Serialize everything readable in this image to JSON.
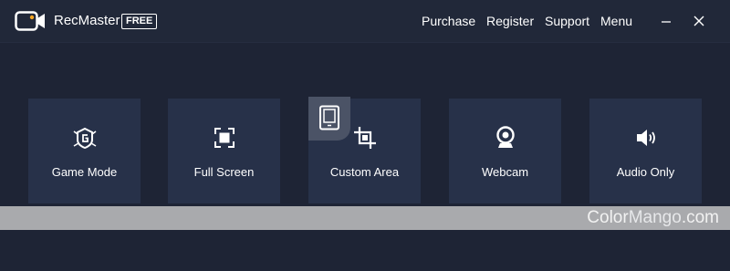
{
  "app": {
    "name": "RecMaster",
    "badge": "FREE"
  },
  "header": {
    "nav": {
      "purchase": "Purchase",
      "register": "Register",
      "support": "Support",
      "menu": "Menu"
    }
  },
  "modes": [
    {
      "label": "Game Mode",
      "icon": "game-mode-icon"
    },
    {
      "label": "Full Screen",
      "icon": "full-screen-icon"
    },
    {
      "label": "Custom Area",
      "icon": "custom-area-icon"
    },
    {
      "label": "Webcam",
      "icon": "webcam-icon"
    },
    {
      "label": "Audio Only",
      "icon": "speaker-icon"
    }
  ],
  "watermark": {
    "part1": "Color",
    "part2": "Mango",
    "part3": ".com"
  },
  "colors": {
    "background": "#1e2435",
    "tile": "#273149",
    "accent_tab": "#4b5366",
    "ad_bar": "#a9aaad"
  }
}
